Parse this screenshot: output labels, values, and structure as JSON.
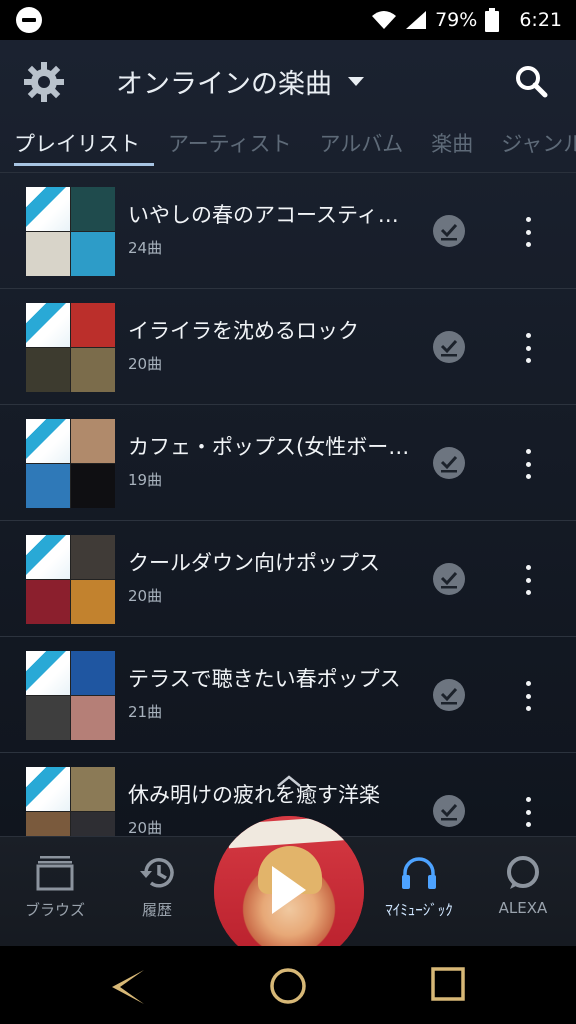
{
  "status_bar": {
    "battery_percent": "79%",
    "time": "6:21",
    "icons": [
      "dnd-icon",
      "wifi-icon",
      "signal-icon",
      "battery-icon"
    ]
  },
  "header": {
    "title": "オンラインの楽曲",
    "icons": [
      "gear-icon",
      "chevron-down-icon",
      "search-icon"
    ]
  },
  "tabs": [
    {
      "label": "プレイリスト",
      "active": true
    },
    {
      "label": "アーティスト",
      "active": false
    },
    {
      "label": "アルバム",
      "active": false
    },
    {
      "label": "楽曲",
      "active": false
    },
    {
      "label": "ジャンル",
      "active": false
    }
  ],
  "playlists": [
    {
      "title": "いやしの春のアコースティ…",
      "count": "24曲",
      "art": [
        "#c7a04a",
        "#1f4b4d",
        "#d8d4c9",
        "#2d9cc8"
      ]
    },
    {
      "title": "イライラを沈めるロック",
      "count": "20曲",
      "art": [
        "#d8d2c4",
        "#bb2f2b",
        "#3d3b2f",
        "#7b6c4b"
      ]
    },
    {
      "title": "カフェ・ポップス(女性ボー…",
      "count": "19曲",
      "art": [
        "#c79a56",
        "#b08a6b",
        "#2f79b8",
        "#0f0f12"
      ]
    },
    {
      "title": "クールダウン向けポップス",
      "count": "20曲",
      "art": [
        "#bbbbbb",
        "#403b37",
        "#8b1f2d",
        "#c2822e"
      ]
    },
    {
      "title": "テラスで聴きたい春ポップス",
      "count": "21曲",
      "art": [
        "#c5d2c4",
        "#1f56a1",
        "#3e3e3e",
        "#b57f77"
      ]
    },
    {
      "title": "休み明けの疲れを癒す洋楽",
      "count": "20曲",
      "art": [
        "#2f2f2f",
        "#8b7a56",
        "#7a5a3d",
        "#2e2e33"
      ]
    }
  ],
  "bottom_nav": [
    {
      "label": "ブラウズ",
      "icon": "browse-icon",
      "active": false
    },
    {
      "label": "履歴",
      "icon": "history-icon",
      "active": false
    },
    {
      "label": "ﾏｲﾐｭｰｼﾞｯｸ",
      "icon": "headphones-icon",
      "active": true
    },
    {
      "label": "ALEXA",
      "icon": "alexa-icon",
      "active": false
    }
  ],
  "player": {
    "state": "paused",
    "icon": "play-icon"
  },
  "colors": {
    "accent": "#a7c4e2",
    "active_nav": "#4da3ff",
    "background": "#161c27"
  }
}
